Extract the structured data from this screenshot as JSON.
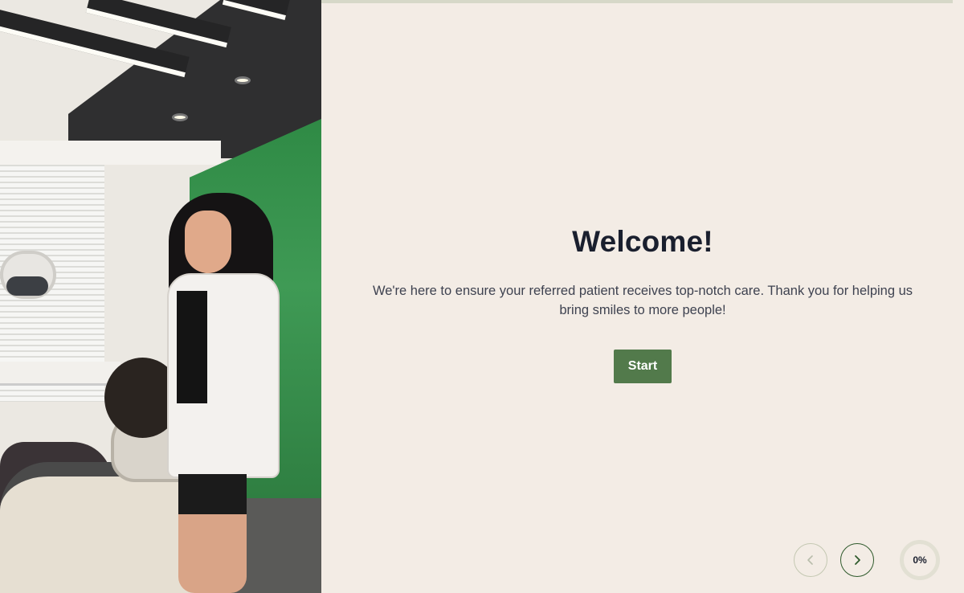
{
  "hero_image": {
    "alt": "",
    "icon": "dental-clinic-photo"
  },
  "welcome": {
    "title": "Welcome!",
    "message": "We're here to ensure your referred patient receives top-notch care. Thank you for helping us bring smiles to more people!",
    "start_label": "Start"
  },
  "navigation": {
    "prev_icon": "chevron-left-icon",
    "next_icon": "chevron-right-icon",
    "progress_label": "0%",
    "progress_value": 0
  },
  "colors": {
    "background": "#f3ece5",
    "accent": "#527a4b",
    "title": "#1a1f2e",
    "text": "#3e4250"
  }
}
